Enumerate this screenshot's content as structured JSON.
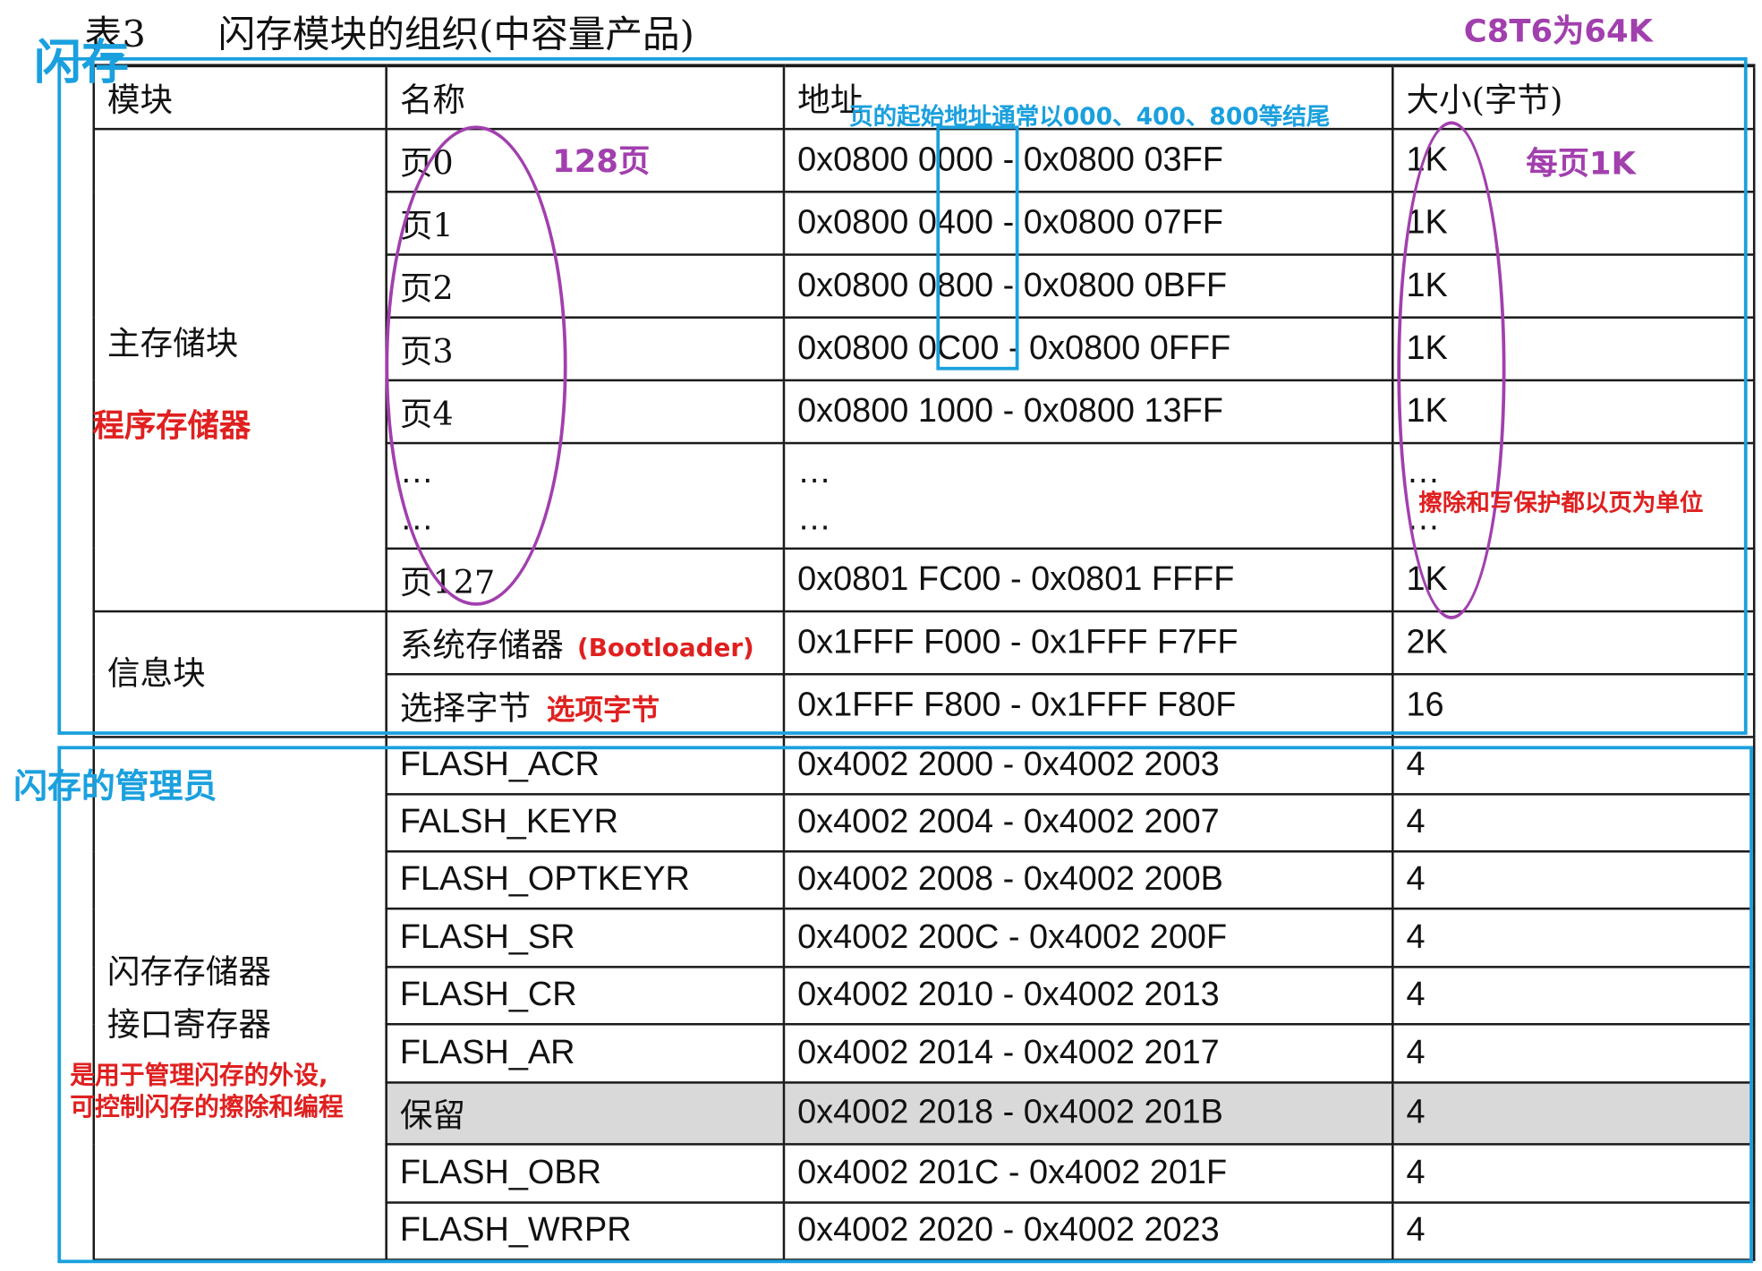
{
  "caption": {
    "table_no": "表3",
    "title": "闪存模块的组织(中容量产品)"
  },
  "headers": [
    "模块",
    "名称",
    "地址",
    "大小(字节)"
  ],
  "main_block": {
    "label": "主存储块",
    "rows": [
      {
        "name": "页0",
        "address": "0x0800 0000 - 0x0800 03FF",
        "size": "1K"
      },
      {
        "name": "页1",
        "address": "0x0800 0400 - 0x0800 07FF",
        "size": "1K"
      },
      {
        "name": "页2",
        "address": "0x0800 0800 - 0x0800 0BFF",
        "size": "1K"
      },
      {
        "name": "页3",
        "address": "0x0800 0C00 - 0x0800 0FFF",
        "size": "1K"
      },
      {
        "name": "页4",
        "address": "0x0800 1000 - 0x0800 13FF",
        "size": "1K"
      },
      {
        "name": "…",
        "name2": "…",
        "address": "…",
        "address2": "…",
        "size": "…",
        "size2": "…"
      },
      {
        "name": "页127",
        "address": "0x0801 FC00 - 0x0801 FFFF",
        "size": "1K"
      }
    ]
  },
  "info_block": {
    "label": "信息块",
    "rows": [
      {
        "name": "系统存储器",
        "address": "0x1FFF F000 - 0x1FFF F7FF",
        "size": "2K"
      },
      {
        "name": "选择字节",
        "address": "0x1FFF F800 - 0x1FFF F80F",
        "size": "16"
      }
    ]
  },
  "interface_block": {
    "label_line1": "闪存存储器",
    "label_line2": "接口寄存器",
    "rows": [
      {
        "name": "FLASH_ACR",
        "address": "0x4002 2000 - 0x4002 2003",
        "size": "4"
      },
      {
        "name": "FALSH_KEYR",
        "address": "0x4002 2004 - 0x4002 2007",
        "size": "4"
      },
      {
        "name": "FLASH_OPTKEYR",
        "address": "0x4002 2008 - 0x4002 200B",
        "size": "4"
      },
      {
        "name": "FLASH_SR",
        "address": "0x4002 200C - 0x4002 200F",
        "size": "4"
      },
      {
        "name": "FLASH_CR",
        "address": "0x4002 2010 - 0x4002 2013",
        "size": "4"
      },
      {
        "name": "FLASH_AR",
        "address": "0x4002 2014 - 0x4002 2017",
        "size": "4"
      },
      {
        "name": "保留",
        "address": "0x4002 2018 - 0x4002 201B",
        "size": "4"
      },
      {
        "name": "FLASH_OBR",
        "address": "0x4002 201C - 0x4002 201F",
        "size": "4"
      },
      {
        "name": "FLASH_WRPR",
        "address": "0x4002 2020 - 0x4002 2023",
        "size": "4"
      }
    ]
  },
  "annotations": {
    "flash_label": "闪存",
    "chip_note": "C8T6为64K",
    "page_start_note": "页的起始地址通常以000、400、800等结尾",
    "page_count": "128页",
    "page_size": "每页1K",
    "program_memory": "程序存储器",
    "erase_note": "擦除和写保护都以页为单位",
    "bootloader": "(Bootloader)",
    "option_bytes": "选项字节",
    "manager_label": "闪存的管理员",
    "peripheral_note_1": "是用于管理闪存的外设,",
    "peripheral_note_2": "可控制闪存的擦除和编程"
  },
  "colors": {
    "annotation_blue": "#1aa0de",
    "annotation_purple": "#a23fae",
    "annotation_red": "#e02020",
    "reserved_row": "#d9d9d9"
  }
}
